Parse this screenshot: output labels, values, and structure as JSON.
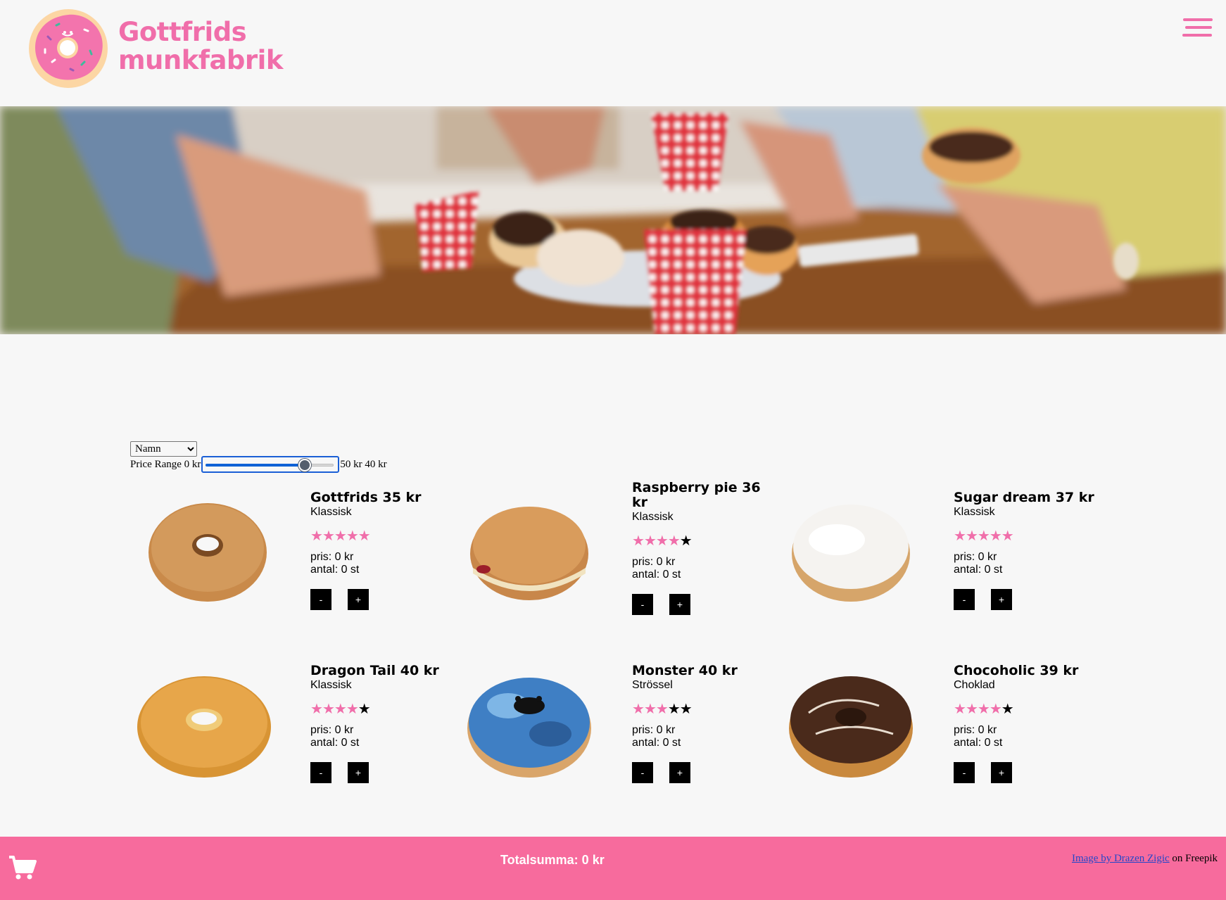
{
  "brand": {
    "name_line1": "Gottfrids",
    "name_line2": "munkfabrik",
    "accent_color": "#f06eaa"
  },
  "header": {
    "menu_icon": "hamburger-menu-icon"
  },
  "hero": {
    "description_icon": "people-eating-donuts-photo"
  },
  "filters": {
    "sort_options": [
      "Namn"
    ],
    "sort_selected": "Namn",
    "price_range_label": "Price Range 0 kr",
    "price_range_max_label": "50 kr 40 kr",
    "price_range_min": 0,
    "price_range_max": 50,
    "price_range_value": 40
  },
  "products": [
    {
      "title": "Gottfrids 35 kr",
      "category": "Klassisk",
      "rating": 5,
      "price_text": "pris: 0 kr",
      "qty_text": "antal: 0 st",
      "minus": "-",
      "plus": "+",
      "image": "sugar-donut"
    },
    {
      "title": "Raspberry pie 36 kr",
      "category": "Klassisk",
      "rating": 4,
      "price_text": "pris: 0 kr",
      "qty_text": "antal: 0 st",
      "minus": "-",
      "plus": "+",
      "image": "raspberry-filled-donut"
    },
    {
      "title": "Sugar dream 37 kr",
      "category": "Klassisk",
      "rating": 5,
      "price_text": "pris: 0 kr",
      "qty_text": "antal: 0 st",
      "minus": "-",
      "plus": "+",
      "image": "powdered-donut"
    },
    {
      "title": "Dragon Tail 40 kr",
      "category": "Klassisk",
      "rating": 4,
      "price_text": "pris: 0 kr",
      "qty_text": "antal: 0 st",
      "minus": "-",
      "plus": "+",
      "image": "coconut-ring-donut"
    },
    {
      "title": "Monster 40 kr",
      "category": "Strössel",
      "rating": 3,
      "price_text": "pris: 0 kr",
      "qty_text": "antal: 0 st",
      "minus": "-",
      "plus": "+",
      "image": "blue-monster-donut"
    },
    {
      "title": "Chocoholic 39 kr",
      "category": "Choklad",
      "rating": 4,
      "price_text": "pris: 0 kr",
      "qty_text": "antal: 0 st",
      "minus": "-",
      "plus": "+",
      "image": "chocolate-donut"
    }
  ],
  "footer": {
    "total_text": "Totalsumma: 0 kr",
    "credit_link": "Image by Drazen Zigic",
    "credit_suffix": " on Freepik",
    "cart_icon": "shopping-cart-icon",
    "footer_color": "#f76b9d"
  }
}
